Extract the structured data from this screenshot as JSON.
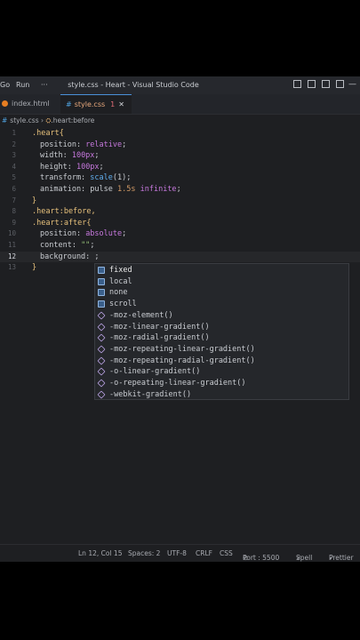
{
  "window": {
    "menu_go": "Go",
    "menu_run": "Run",
    "menu_more": "···",
    "title": "style.css - Heart - Visual Studio Code"
  },
  "tabs": [
    {
      "label": "index.html"
    },
    {
      "label": "style.css",
      "badge": "1",
      "close": "✕"
    }
  ],
  "breadcrumb": {
    "file": "style.css",
    "separator": "›",
    "symbol": ".heart:before"
  },
  "editor": {
    "lines": [
      {
        "n": "1"
      },
      {
        "n": "2"
      },
      {
        "n": "3"
      },
      {
        "n": "4"
      },
      {
        "n": "5"
      },
      {
        "n": "6"
      },
      {
        "n": "7"
      },
      {
        "n": "8"
      },
      {
        "n": "9"
      },
      {
        "n": "10"
      },
      {
        "n": "11"
      },
      {
        "n": "12"
      },
      {
        "n": "13"
      }
    ],
    "code": {
      "l1_sel": ".heart",
      "l1_brace": "{",
      "l2_prop": "position: ",
      "l2_val": "relative",
      "l3_prop": "width: ",
      "l3_val": "100px",
      "l4_prop": "height: ",
      "l4_val": "100px",
      "l5_prop": "transform: ",
      "l5_fn": "scale",
      "l5_arg": "(1);",
      "l6_prop": "animation: ",
      "l6_name": "pulse ",
      "l6_dur": "1.5s ",
      "l6_inf": "infinite",
      "l6_end": ";",
      "l7_brace": "}",
      "l8_sel": ".heart:before,",
      "l9_sel": ".heart:after",
      "l9_brace": "{",
      "l10_prop": "position: ",
      "l10_val": "absolute",
      "l11_prop": "content: ",
      "l11_str": "\"\"",
      "l11_end": ";",
      "l12_prop": "background: ",
      "l12_end": ";",
      "l13_brace": "}",
      "semicolon": ";"
    }
  },
  "suggestions": [
    {
      "label": "fixed",
      "kind": "value"
    },
    {
      "label": "local",
      "kind": "value"
    },
    {
      "label": "none",
      "kind": "value"
    },
    {
      "label": "scroll",
      "kind": "value"
    },
    {
      "label": "-moz-element()",
      "kind": "function"
    },
    {
      "label": "-moz-linear-gradient()",
      "kind": "function"
    },
    {
      "label": "-moz-radial-gradient()",
      "kind": "function"
    },
    {
      "label": "-moz-repeating-linear-gradient()",
      "kind": "function"
    },
    {
      "label": "-moz-repeating-radial-gradient()",
      "kind": "function"
    },
    {
      "label": "-o-linear-gradient()",
      "kind": "function"
    },
    {
      "label": "-o-repeating-linear-gradient()",
      "kind": "function"
    },
    {
      "label": "-webkit-gradient()",
      "kind": "function"
    }
  ],
  "status": {
    "position": "Ln 12, Col 15",
    "spaces": "Spaces: 2",
    "encoding": "UTF-8",
    "eol": "CRLF",
    "language": "CSS",
    "port": "Port : 5500",
    "spell": "Spell",
    "prettier": "Prettier"
  }
}
